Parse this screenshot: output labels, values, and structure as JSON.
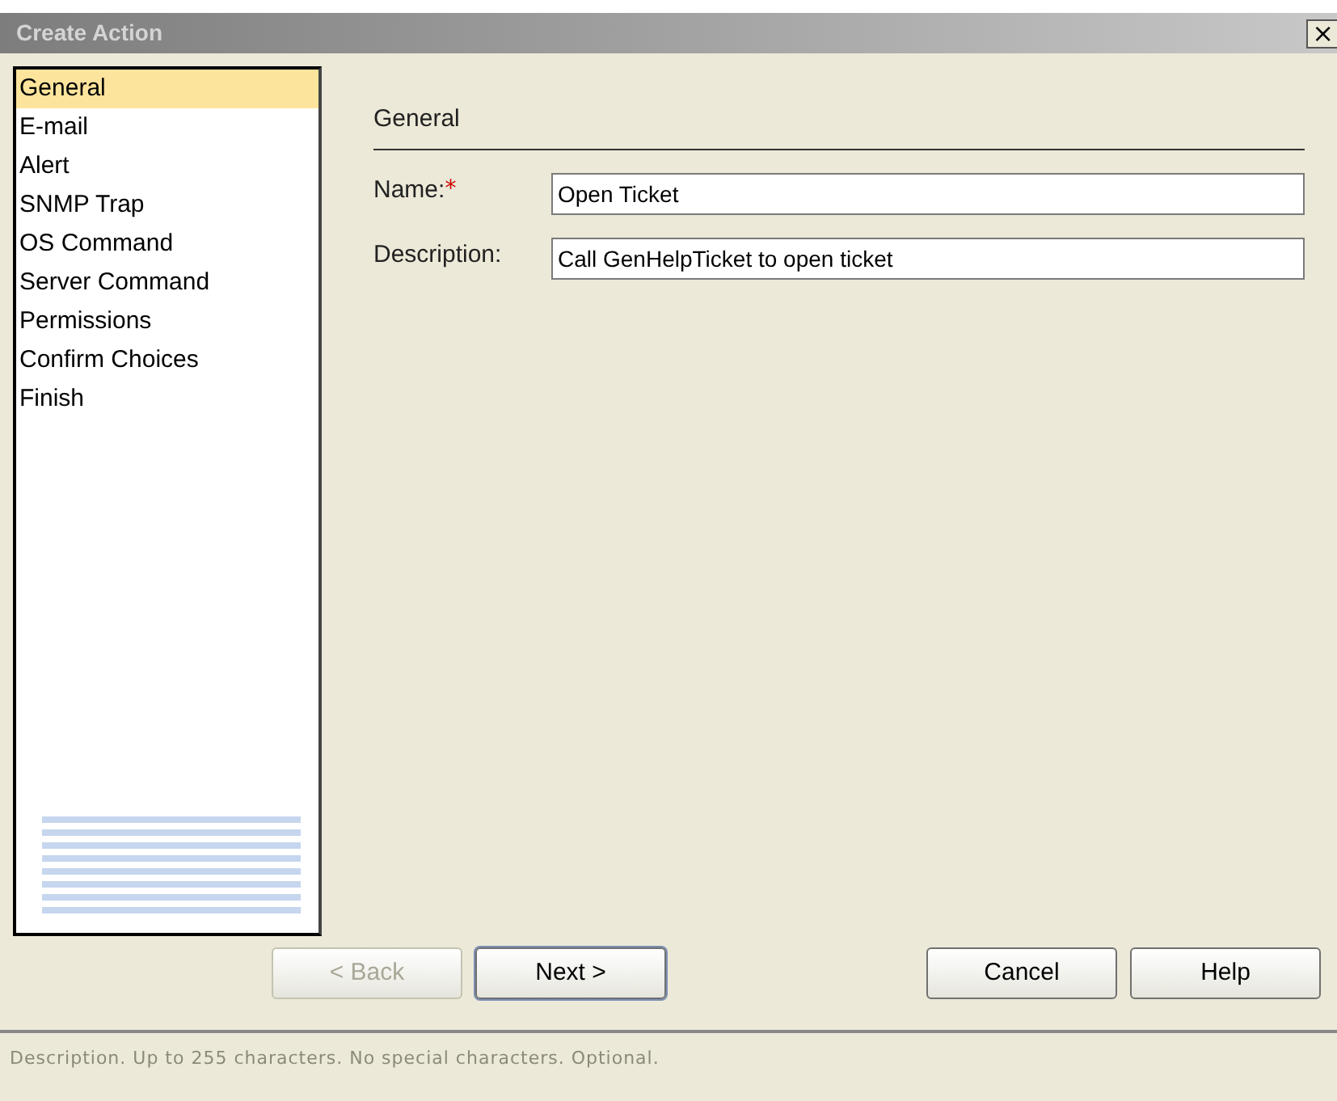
{
  "window": {
    "title": "Create Action",
    "close": "×"
  },
  "steps": [
    {
      "label": "General",
      "selected": true
    },
    {
      "label": "E-mail",
      "selected": false
    },
    {
      "label": "Alert",
      "selected": false
    },
    {
      "label": "SNMP Trap",
      "selected": false
    },
    {
      "label": "OS Command",
      "selected": false
    },
    {
      "label": "Server Command",
      "selected": false
    },
    {
      "label": "Permissions",
      "selected": false
    },
    {
      "label": "Confirm Choices",
      "selected": false
    },
    {
      "label": "Finish",
      "selected": false
    }
  ],
  "section_title": "General",
  "fields": [
    {
      "label": "Name:",
      "required_mark": "*",
      "value": "Open Ticket"
    },
    {
      "label": "Description:",
      "value": "Call GenHelpTicket to open ticket"
    }
  ],
  "buttons": [
    {
      "label": "< Back",
      "disabled": true,
      "default": false
    },
    {
      "label": "Next >",
      "disabled": false,
      "default": true
    },
    {
      "label": "Cancel",
      "disabled": false,
      "default": false
    },
    {
      "label": "Help",
      "disabled": false,
      "default": false
    }
  ],
  "status_bar": "Description. Up to 255 characters. No special characters. Optional."
}
